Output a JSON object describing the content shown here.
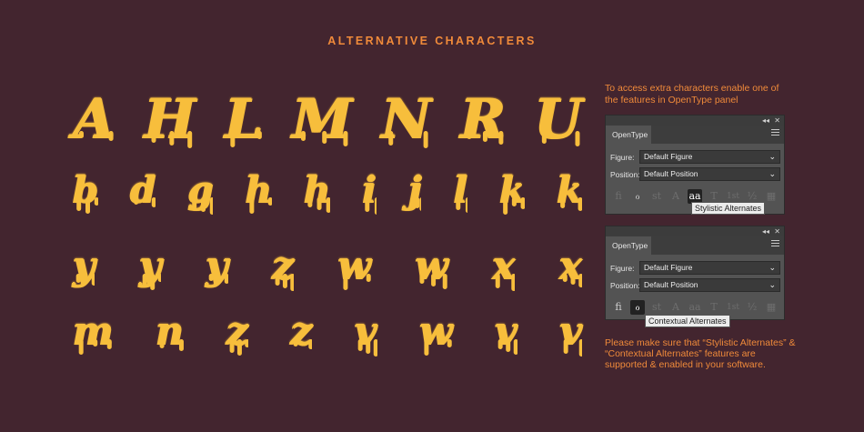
{
  "heading": "ALTERNATIVE CHARACTERS",
  "glyph_rows": [
    {
      "chars": [
        "A",
        "H",
        "L",
        "M",
        "N",
        "R",
        "U"
      ],
      "size": 60
    },
    {
      "chars": [
        "b",
        "d",
        "g",
        "h",
        "h",
        "i",
        "j",
        "l",
        "k",
        "k"
      ],
      "size": 40
    },
    {
      "chars": [
        "y",
        "y",
        "y",
        "z",
        "w",
        "w",
        "x",
        "x"
      ],
      "size": 42
    },
    {
      "chars": [
        "m",
        "n",
        "z",
        "z",
        "v",
        "w",
        "v",
        "v"
      ],
      "size": 42
    }
  ],
  "colors": {
    "background": "#43252f",
    "accent": "#f08a3a",
    "glyph": "#f7be3c"
  },
  "info_text": "To access extra characters enable one of the features in OpenType panel",
  "panels": [
    {
      "tab": "OpenType",
      "collapse_icon": "◂◂",
      "close_icon": "✕",
      "figure_label": "Figure:",
      "figure_value": "Default Figure",
      "position_label": "Position:",
      "position_value": "Default Position",
      "icons": [
        "fi",
        "ℴ",
        "st",
        "A",
        "aa",
        "T",
        "1st",
        "½",
        "▦"
      ],
      "tooltip": "Stylistic Alternates"
    },
    {
      "tab": "OpenType",
      "collapse_icon": "◂◂",
      "close_icon": "✕",
      "figure_label": "Figure:",
      "figure_value": "Default Figure",
      "position_label": "Position:",
      "position_value": "Default Position",
      "icons": [
        "fi",
        "ℴ",
        "st",
        "A",
        "aa",
        "T",
        "1st",
        "½",
        "▦"
      ],
      "tooltip": "Contextual Alternates"
    }
  ],
  "note_text": "Please make sure that “Stylistic Alternates” & “Contextual Alternates” features are supported & enabled in your software."
}
